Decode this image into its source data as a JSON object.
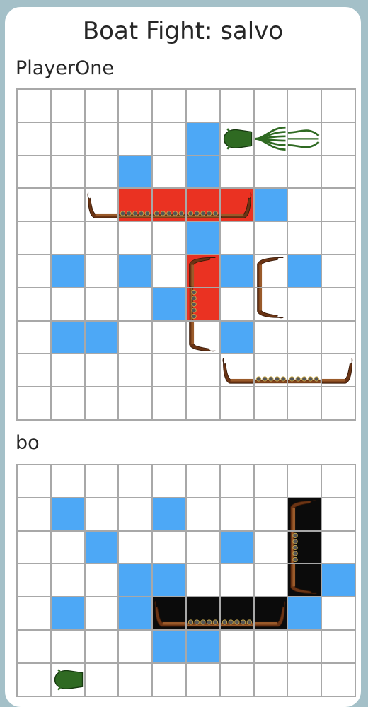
{
  "title": "Boat Fight: salvo",
  "colors": {
    "background": "#a4c0c8",
    "card": "#ffffff",
    "miss": "#4da8f6",
    "hit": "#ea3222",
    "sunk": "#0b0b0b",
    "grid_line": "#a8a8a8"
  },
  "boards": [
    {
      "player_name": "PlayerOne",
      "rows": 10,
      "cols": 10,
      "misses": [
        [
          1,
          5
        ],
        [
          2,
          3
        ],
        [
          2,
          5
        ],
        [
          3,
          7
        ],
        [
          4,
          5
        ],
        [
          5,
          1
        ],
        [
          5,
          3
        ],
        [
          5,
          6
        ],
        [
          5,
          8
        ],
        [
          6,
          4
        ],
        [
          7,
          1
        ],
        [
          7,
          2
        ],
        [
          7,
          6
        ]
      ],
      "hits": [
        [
          3,
          3
        ],
        [
          3,
          4
        ],
        [
          3,
          5
        ],
        [
          3,
          6
        ],
        [
          5,
          5
        ],
        [
          6,
          5
        ]
      ],
      "sunk": [],
      "ships": [
        {
          "name": "horizontal-longship",
          "row": 3,
          "col": 2,
          "length": 5,
          "orientation": "horizontal"
        },
        {
          "name": "vertical-longship",
          "row": 5,
          "col": 5,
          "length": 3,
          "orientation": "vertical"
        },
        {
          "name": "small-vertical-longship",
          "row": 5,
          "col": 7,
          "length": 2,
          "orientation": "vertical"
        },
        {
          "name": "horizontal-longship",
          "row": 8,
          "col": 6,
          "length": 4,
          "orientation": "horizontal"
        },
        {
          "name": "kraken",
          "row": 1,
          "col": 6,
          "length": 3,
          "orientation": "horizontal"
        }
      ]
    },
    {
      "player_name": "bo",
      "rows": 7,
      "cols": 10,
      "misses": [
        [
          1,
          1
        ],
        [
          1,
          4
        ],
        [
          2,
          2
        ],
        [
          2,
          6
        ],
        [
          3,
          3
        ],
        [
          3,
          4
        ],
        [
          3,
          9
        ],
        [
          4,
          1
        ],
        [
          4,
          3
        ],
        [
          4,
          8
        ],
        [
          5,
          4
        ],
        [
          5,
          5
        ]
      ],
      "hits": [],
      "sunk": [
        [
          1,
          8
        ],
        [
          2,
          8
        ],
        [
          3,
          8
        ],
        [
          4,
          4
        ],
        [
          4,
          5
        ],
        [
          4,
          6
        ],
        [
          4,
          7
        ]
      ],
      "ships": [
        {
          "name": "vertical-longship",
          "row": 1,
          "col": 8,
          "length": 3,
          "orientation": "vertical"
        },
        {
          "name": "horizontal-longship",
          "row": 4,
          "col": 4,
          "length": 4,
          "orientation": "horizontal"
        },
        {
          "name": "kraken",
          "row": 6,
          "col": 1,
          "length": 1,
          "orientation": "horizontal"
        }
      ]
    }
  ]
}
